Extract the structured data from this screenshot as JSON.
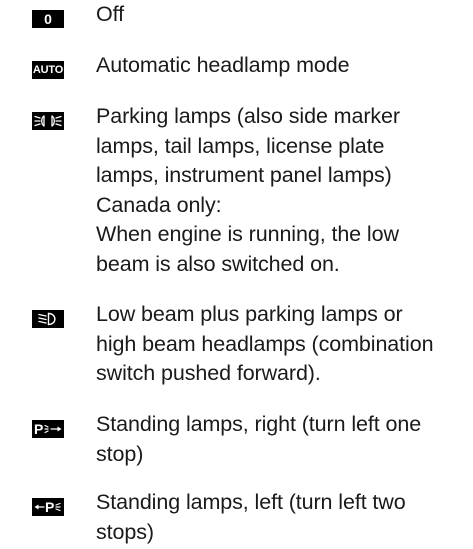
{
  "entries": [
    {
      "symbol": "0",
      "symbol_icon": "off-symbol",
      "lines": [
        "Off"
      ]
    },
    {
      "symbol": "AUTO",
      "symbol_icon": "auto-symbol",
      "lines": [
        "Automatic headlamp mode"
      ]
    },
    {
      "symbol": "",
      "symbol_icon": "parking-lamps-symbol",
      "lines": [
        "Parking lamps (also side marker",
        "lamps, tail lamps, license plate",
        "lamps, instrument panel lamps)",
        "Canada only:",
        "When engine is running, the low",
        "beam is also switched on."
      ]
    },
    {
      "symbol": "",
      "symbol_icon": "low-beam-symbol",
      "lines": [
        "Low beam plus parking lamps or",
        "high beam headlamps (combination",
        "switch pushed forward)."
      ]
    },
    {
      "symbol": "P",
      "symbol_icon": "standing-lamps-right-symbol",
      "lines": [
        "Standing lamps, right (turn left one",
        "stop)"
      ]
    },
    {
      "symbol": "P",
      "symbol_icon": "standing-lamps-left-symbol",
      "lines": [
        "Standing lamps, left (turn left two",
        "stops)"
      ]
    }
  ],
  "colors": {
    "badge_background": "#000000",
    "badge_foreground": "#ffffff",
    "text": "#1a1a1a"
  }
}
